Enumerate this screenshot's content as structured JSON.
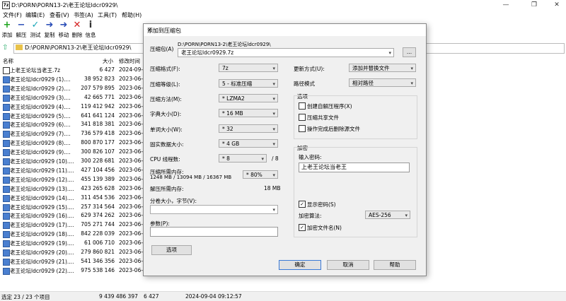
{
  "window": {
    "title": "D:\\PORN\\PORN13-2\\老王论坛ldcr0929\\",
    "app_icon": "7z",
    "minimize": "—",
    "maximize": "❐",
    "close": "✕"
  },
  "menu": [
    "文件(F)",
    "编辑(E)",
    "查看(V)",
    "书签(A)",
    "工具(T)",
    "帮助(H)"
  ],
  "toolbar": [
    {
      "label": "添加",
      "icon": "+",
      "color": "#1ea51e"
    },
    {
      "label": "解压",
      "icon": "−",
      "color": "#2c4fb8"
    },
    {
      "label": "测试",
      "icon": "✓",
      "color": "#1aa6b7"
    },
    {
      "label": "复制",
      "icon": "➜",
      "color": "#2c4fb8"
    },
    {
      "label": "移动",
      "icon": "➜",
      "color": "#2c4fb8"
    },
    {
      "label": "删除",
      "icon": "✕",
      "color": "#d42020"
    },
    {
      "label": "信息",
      "icon": "i",
      "color": "#333333"
    }
  ],
  "address": {
    "path": "D:\\PORN\\PORN13-2\\老王论坛ldcr0929\\"
  },
  "file_list": {
    "headers": {
      "name": "名称",
      "size": "大小",
      "modified": "修改时间"
    },
    "rows": [
      {
        "name": "上老王论坛当老王.7z",
        "size": "6 427",
        "modified": "2024-09-0"
      },
      {
        "name": "老王论坛ldcr0929 (1)....",
        "size": "38 952 823",
        "modified": "2023-06-0"
      },
      {
        "name": "老王论坛ldcr0929 (2)....",
        "size": "207 579 895",
        "modified": "2023-06-0"
      },
      {
        "name": "老王论坛ldcr0929 (3)....",
        "size": "42 665 771",
        "modified": "2023-06-0"
      },
      {
        "name": "老王论坛ldcr0929 (4)....",
        "size": "119 412 942",
        "modified": "2023-06-0"
      },
      {
        "name": "老王论坛ldcr0929 (5)....",
        "size": "641 641 124",
        "modified": "2023-06-0"
      },
      {
        "name": "老王论坛ldcr0929 (6)....",
        "size": "341 818 381",
        "modified": "2023-06-0"
      },
      {
        "name": "老王论坛ldcr0929 (7)....",
        "size": "736 579 418",
        "modified": "2023-06-0"
      },
      {
        "name": "老王论坛ldcr0929 (8)....",
        "size": "800 870 177",
        "modified": "2023-06-0"
      },
      {
        "name": "老王论坛ldcr0929 (9)....",
        "size": "300 826 107",
        "modified": "2023-06-0"
      },
      {
        "name": "老王论坛ldcr0929 (10)....",
        "size": "300 228 681",
        "modified": "2023-06-0"
      },
      {
        "name": "老王论坛ldcr0929 (11)....",
        "size": "427 104 456",
        "modified": "2023-06-0"
      },
      {
        "name": "老王论坛ldcr0929 (12)....",
        "size": "455 139 389",
        "modified": "2023-06-0"
      },
      {
        "name": "老王论坛ldcr0929 (13)....",
        "size": "423 265 628",
        "modified": "2023-06-0"
      },
      {
        "name": "老王论坛ldcr0929 (14)....",
        "size": "311 454 536",
        "modified": "2023-06-0"
      },
      {
        "name": "老王论坛ldcr0929 (15)....",
        "size": "257 314 564",
        "modified": "2023-06-0"
      },
      {
        "name": "老王论坛ldcr0929 (16)....",
        "size": "629 374 262",
        "modified": "2023-06-0"
      },
      {
        "name": "老王论坛ldcr0929 (17)....",
        "size": "705 271 744",
        "modified": "2023-06-0"
      },
      {
        "name": "老王论坛ldcr0929 (18)....",
        "size": "842 228 039",
        "modified": "2023-06-0"
      },
      {
        "name": "老王论坛ldcr0929 (19)....",
        "size": "61 006 710",
        "modified": "2023-06-0"
      },
      {
        "name": "老王论坛ldcr0929 (20)....",
        "size": "279 860 821",
        "modified": "2023-06-0"
      },
      {
        "name": "老王论坛ldcr0929 (21)....",
        "size": "541 346 356",
        "modified": "2023-06-0"
      },
      {
        "name": "老王论坛ldcr0929 (22)....",
        "size": "975 538 146",
        "modified": "2023-06-0"
      }
    ]
  },
  "status": {
    "selected": "选定 23 / 23 个项目",
    "total_size": "9 439 486 397",
    "item_size": "6 427",
    "date": "2024-09-04 09:12:57"
  },
  "dialog": {
    "title": "添加到压缩包",
    "close": "✕",
    "archive_label": "压缩包(A)",
    "archive_dir": "D:\\PORN\\PORN13-2\\老王论坛ldcr0929\\",
    "archive_name": "老王论坛ldcr0929.7z",
    "browse": "...",
    "format_label": "压缩格式(F):",
    "format_value": "7z",
    "level_label": "压缩等级(L):",
    "level_value": "5 - 标准压缩",
    "method_label": "压缩方法(M):",
    "method_value": "* LZMA2",
    "dict_label": "字典大小(D):",
    "dict_value": "* 16 MB",
    "word_label": "单词大小(W):",
    "word_value": "* 32",
    "solid_label": "固实数据大小:",
    "solid_value": "* 4 GB",
    "cpu_label": "CPU 线程数:",
    "cpu_value": "* 8",
    "cpu_max": "/ 8",
    "mem_label": "压缩所需内存:",
    "mem_detail": "1248 MB / 13094 MB / 16367 MB",
    "mem_pct": "* 80%",
    "decomp_label": "解压所需内存:",
    "decomp_value": "18 MB",
    "split_label": "分卷大小，字节(V):",
    "params_label": "参数(P):",
    "options_btn": "选项",
    "update_label": "更新方式(U):",
    "update_value": "添加并替换文件",
    "path_label": "路径模式",
    "path_value": "相对路径",
    "options_group": "选项",
    "opt_sfx": "创建自解压程序(X)",
    "opt_shared": "压缩共享文件",
    "opt_delete": "操作完成后删除源文件",
    "enc_group": "加密",
    "pwd_label": "输入密码:",
    "pwd_value": "上老王论坛当老王",
    "show_pwd": "显示密码(S)",
    "enc_method_label": "加密算法:",
    "enc_method_value": "AES-256",
    "enc_names": "加密文件名(N)",
    "ok": "确定",
    "cancel": "取消",
    "help": "帮助",
    "check": "✓",
    "dropdown_icon": "▾"
  }
}
